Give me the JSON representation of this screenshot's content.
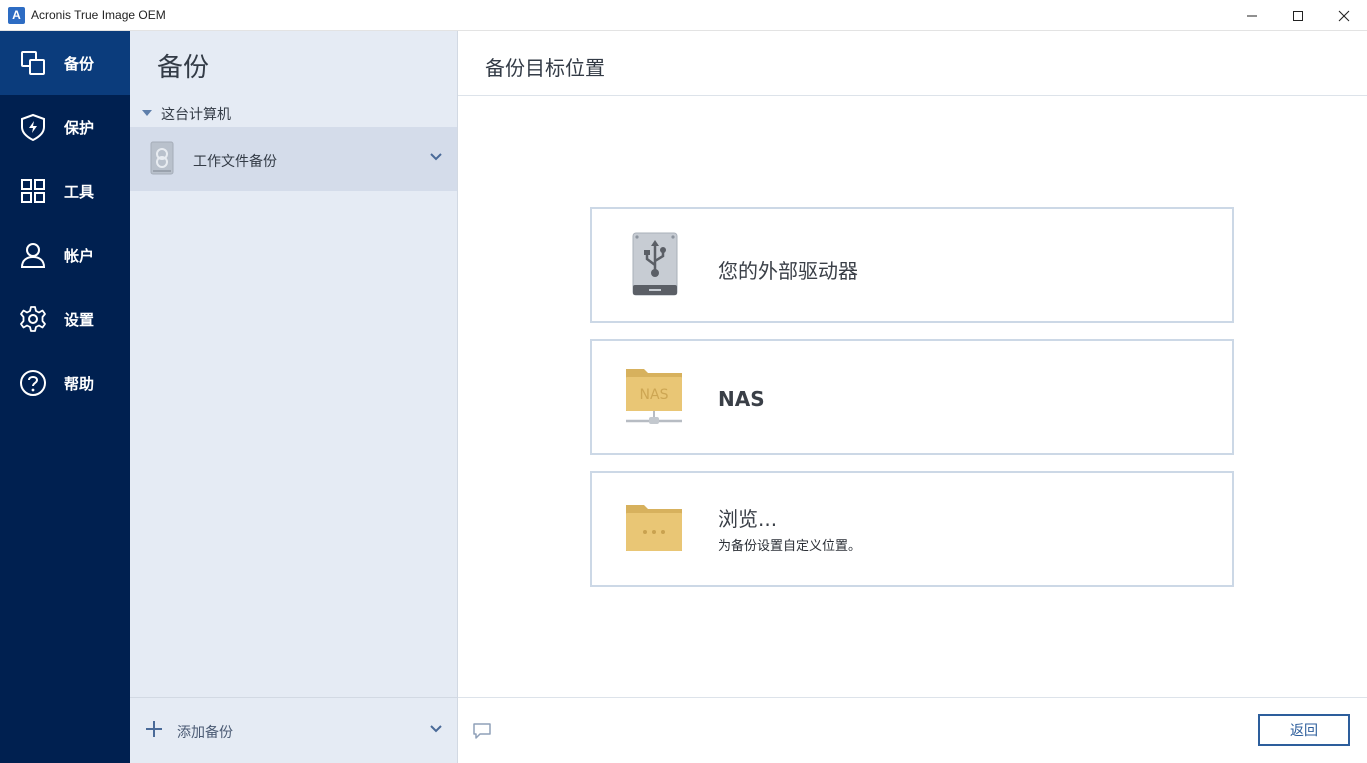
{
  "window": {
    "logo_letter": "A",
    "title": "Acronis True Image OEM"
  },
  "nav": {
    "items": [
      {
        "label": "备份",
        "icon": "backup-icon",
        "active": true
      },
      {
        "label": "保护",
        "icon": "shield-icon",
        "active": false
      },
      {
        "label": "工具",
        "icon": "tools-grid-icon",
        "active": false
      },
      {
        "label": "帐户",
        "icon": "account-icon",
        "active": false
      },
      {
        "label": "设置",
        "icon": "gear-icon",
        "active": false
      },
      {
        "label": "帮助",
        "icon": "help-icon",
        "active": false
      }
    ]
  },
  "backups_panel": {
    "title": "备份",
    "group_label": "这台计算机",
    "items": [
      {
        "label": "工作文件备份",
        "icon": "drive-icon"
      }
    ],
    "add_label": "添加备份"
  },
  "destination": {
    "title": "备份目标位置",
    "options": [
      {
        "title": "您的外部驱动器",
        "subtitle": "",
        "icon": "usb-drive-icon"
      },
      {
        "title": "NAS",
        "subtitle": "",
        "icon": "nas-folder-icon",
        "icon_text": "NAS"
      },
      {
        "title": "浏览...",
        "subtitle": "为备份设置自定义位置。",
        "icon": "browse-folder-icon"
      }
    ],
    "back_label": "返回"
  },
  "colors": {
    "nav_bg": "#002050",
    "nav_active": "#0b3c7c",
    "panel_bg": "#e5ebf4",
    "accent": "#2d5e9c"
  }
}
